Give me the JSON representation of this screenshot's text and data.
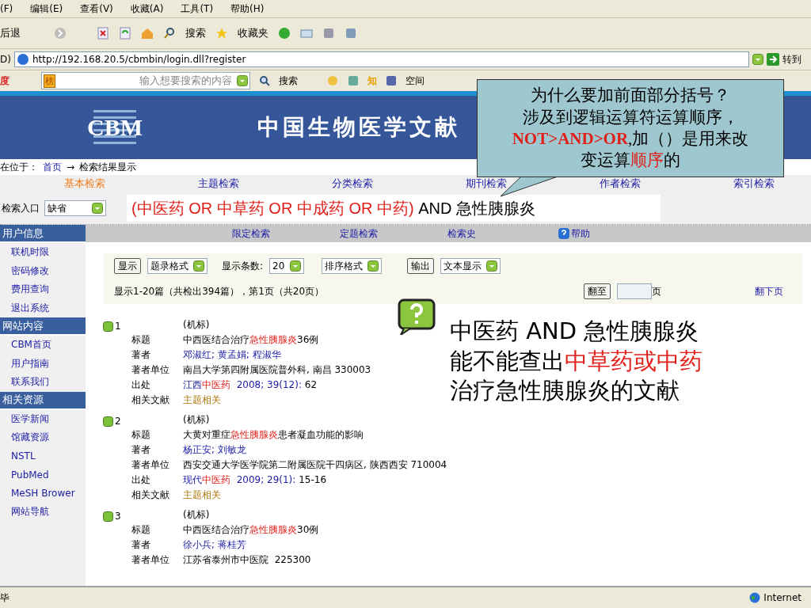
{
  "menu": [
    "(F)",
    "编辑(E)",
    "查看(V)",
    "收藏(A)",
    "工具(T)",
    "帮助(H)"
  ],
  "toolbar": {
    "back": "后退",
    "search": "搜索",
    "favorites": "收藏夹"
  },
  "address": {
    "label": "D)",
    "url": "http://192.168.20.5/cbmbin/login.dll?register",
    "go": "转到"
  },
  "search_bar": {
    "logo": "度",
    "rank": "榜",
    "placeholder": "输入想要搜索的内容",
    "search": "搜索",
    "know": "知",
    "space": "空间"
  },
  "banner": {
    "logo": "CBM",
    "title": "中国生物医学文献"
  },
  "breadcrumb": {
    "label": "在位于：",
    "home": "首页",
    "arrow": "→",
    "current": "检索结果显示"
  },
  "tabs": [
    {
      "label": "基本检索",
      "selected": true
    },
    {
      "label": "主题检索",
      "selected": false
    },
    {
      "label": "分类检索",
      "selected": false
    },
    {
      "label": "期刊检索",
      "selected": false
    },
    {
      "label": "作者检索",
      "selected": false
    },
    {
      "label": "索引检索",
      "selected": false
    }
  ],
  "entry": {
    "label": "检索入口",
    "value": "缺省"
  },
  "query": [
    {
      "t": "(中医药 OR 中草药 OR 中成药 OR 中药)",
      "kind": "hit"
    },
    {
      "t": " AND 急性胰腺炎",
      "kind": "plain"
    }
  ],
  "sidebar": [
    {
      "title": "用户信息",
      "items": [
        "联机时限",
        "密码修改",
        "费用查询",
        "退出系统"
      ]
    },
    {
      "title": "网站内容",
      "items": [
        "CBM首页",
        "用户指南",
        "联系我们"
      ]
    },
    {
      "title": "相关资源",
      "items": [
        "医学新闻",
        "馆藏资源",
        "NSTL",
        "PubMed",
        "MeSH Brower",
        "网站导航"
      ]
    }
  ],
  "subnav": [
    {
      "label": "限定检索",
      "kind": "link"
    },
    {
      "label": "定题检索",
      "kind": "link"
    },
    {
      "label": "检索史",
      "kind": "link"
    },
    {
      "label": "帮助",
      "kind": "help"
    }
  ],
  "options": {
    "show": "显示",
    "format": "题录格式",
    "count_label": "显示条数:",
    "count": "20",
    "sort": "排序格式",
    "export": "输出",
    "output": "文本显示",
    "summary": "显示1-20篇（共检出394篇），第1页（共20页）",
    "goto": "翻至",
    "page": "页",
    "next": "翻下页"
  },
  "records": [
    {
      "num": "1",
      "kind": "(机标)",
      "fields": [
        {
          "label": "标题",
          "parts": [
            {
              "t": "中西医结合治疗",
              "kind": "plain"
            },
            {
              "t": "急性胰腺炎",
              "kind": "hit"
            },
            {
              "t": "36例",
              "kind": "plain"
            }
          ]
        },
        {
          "label": "著者",
          "parts": [
            {
              "t": "邓淑红; 黄孟娟; 程淑华",
              "kind": "link"
            }
          ]
        },
        {
          "label": "著者单位",
          "parts": [
            {
              "t": "南昌大学第四附属医院普外科, 南昌 330003",
              "kind": "plain"
            }
          ]
        },
        {
          "label": "出处",
          "parts": [
            {
              "t": "江西",
              "kind": "link"
            },
            {
              "t": "中医药",
              "kind": "hit"
            },
            {
              "t": "  2008; 39(12): ",
              "kind": "link"
            },
            {
              "t": "62",
              "kind": "plain"
            }
          ]
        },
        {
          "label": "相关文献",
          "parts": [
            {
              "t": "主题相关",
              "kind": "related"
            }
          ]
        }
      ]
    },
    {
      "num": "2",
      "kind": "(机标)",
      "fields": [
        {
          "label": "标题",
          "parts": [
            {
              "t": "大黄对重症",
              "kind": "plain"
            },
            {
              "t": "急性胰腺炎",
              "kind": "hit"
            },
            {
              "t": "患者凝血功能的影响",
              "kind": "plain"
            }
          ]
        },
        {
          "label": "著者",
          "parts": [
            {
              "t": "杨正安; 刘敏龙",
              "kind": "link"
            }
          ]
        },
        {
          "label": "著者单位",
          "parts": [
            {
              "t": "西安交通大学医学院第二附属医院干四病区, 陕西西安 710004",
              "kind": "plain"
            }
          ]
        },
        {
          "label": "出处",
          "parts": [
            {
              "t": "现代",
              "kind": "link"
            },
            {
              "t": "中医药",
              "kind": "hit"
            },
            {
              "t": "  2009; 29(1): ",
              "kind": "link"
            },
            {
              "t": "15-16",
              "kind": "plain"
            }
          ]
        },
        {
          "label": "相关文献",
          "parts": [
            {
              "t": "主题相关",
              "kind": "related"
            }
          ]
        }
      ]
    },
    {
      "num": "3",
      "kind": "(机标)",
      "fields": [
        {
          "label": "标题",
          "parts": [
            {
              "t": "中西医结合治疗",
              "kind": "plain"
            },
            {
              "t": "急性胰腺炎",
              "kind": "hit"
            },
            {
              "t": "30例",
              "kind": "plain"
            }
          ]
        },
        {
          "label": "著者",
          "parts": [
            {
              "t": "徐小兵; 蒋桂芳",
              "kind": "link"
            }
          ]
        },
        {
          "label": "著者单位",
          "parts": [
            {
              "t": "江苏省泰州市中医院  225300",
              "kind": "plain"
            }
          ]
        }
      ]
    }
  ],
  "status": {
    "text": "毕",
    "zone": "Internet"
  },
  "callout": [
    [
      {
        "t": "为什么要加前面部分括号？",
        "kind": "plain"
      }
    ],
    [
      {
        "t": "涉及到逻辑运算符运算顺序，",
        "kind": "plain"
      }
    ],
    [
      {
        "t": "NOT>AND>OR",
        "kind": "emphasis"
      },
      {
        "t": ",加（）是用来改",
        "kind": "plain"
      }
    ],
    [
      {
        "t": "变运算",
        "kind": "plain"
      },
      {
        "t": "顺序",
        "kind": "hit"
      },
      {
        "t": "的",
        "kind": "plain"
      }
    ]
  ],
  "note": [
    [
      {
        "t": "中医药 AND 急性胰腺炎",
        "kind": "plain"
      }
    ],
    [
      {
        "t": "能不能查出",
        "kind": "plain"
      },
      {
        "t": "中草药或中药",
        "kind": "hit"
      }
    ],
    [
      {
        "t": "治疗急性胰腺炎的文献",
        "kind": "plain"
      }
    ]
  ]
}
